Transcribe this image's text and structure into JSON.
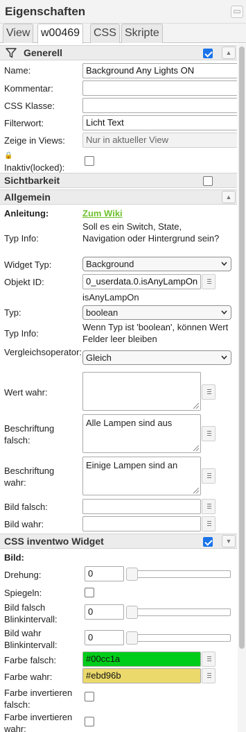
{
  "header": {
    "title": "Eigenschaften",
    "window_btn": "▭"
  },
  "tabs": [
    {
      "label": "View"
    },
    {
      "label": "w00469"
    },
    {
      "label": "CSS"
    },
    {
      "label": "Skripte"
    }
  ],
  "generell": {
    "title": "Generell",
    "name_label": "Name:",
    "name_value": "Background Any Lights ON",
    "kommentar_label": "Kommentar:",
    "kommentar_value": "",
    "css_klasse_label": "CSS Klasse:",
    "css_klasse_value": "",
    "filterwort_label": "Filterwort:",
    "filterwort_value": "Licht Text",
    "zeige_label": "Zeige in Views:",
    "zeige_value": "Nur in aktueller View",
    "inaktiv_label": "Inaktiv(locked):",
    "lock_glyph": "🔒"
  },
  "sichtbarkeit": {
    "title": "Sichtbarkeit"
  },
  "allgemein": {
    "title": "Allgemein",
    "anleitung_label": "Anleitung:",
    "anleitung_link": "Zum Wiki",
    "typinfo1_label": "Typ Info:",
    "typinfo1_text": "Soll es ein Switch, State, Navigation oder Hintergrund sein?",
    "widget_typ_label": "Widget Typ:",
    "widget_typ_value": "Background",
    "objekt_id_label": "Objekt ID:",
    "objekt_id_value": "0_userdata.0.isAnyLampOn",
    "objekt_id_name": "isAnyLampOn",
    "typ_label": "Typ:",
    "typ_value": "boolean",
    "typinfo2_label": "Typ Info:",
    "typinfo2_text": "Wenn Typ ist 'boolean', können Wert Felder leer bleiben",
    "vergleich_label": "Vergleichsoperator:",
    "vergleich_value": "Gleich",
    "wert_wahr_label": "Wert wahr:",
    "wert_wahr_value": "",
    "beschr_falsch_label": "Beschriftung falsch:",
    "beschr_falsch_value": "Alle Lampen sind aus",
    "beschr_wahr_label": "Beschriftung wahr:",
    "beschr_wahr_value": "Einige Lampen sind an",
    "bild_falsch_label": "Bild falsch:",
    "bild_falsch_value": "",
    "bild_wahr_label": "Bild wahr:",
    "bild_wahr_value": ""
  },
  "css_inventwo": {
    "title": "CSS inventwo Widget",
    "bild_label": "Bild:",
    "drehung_label": "Drehung:",
    "drehung_value": "0",
    "drehung_level": 0,
    "spiegeln_label": "Spiegeln:",
    "bild_falsch_blink_label": "Bild falsch Blinkintervall:",
    "bild_falsch_blink_value": "0",
    "bild_falsch_blink_level": 0,
    "bild_wahr_blink_label": "Bild wahr Blinkintervall:",
    "bild_wahr_blink_value": "0",
    "bild_wahr_blink_level": 0,
    "farbe_falsch_label": "Farbe falsch:",
    "farbe_falsch_value": "#00cc1a",
    "farbe_wahr_label": "Farbe wahr:",
    "farbe_wahr_value": "#ebd96b",
    "farbe_inv_falsch_label": "Farbe invertieren falsch:",
    "farbe_inv_wahr_label": "Farbe invertieren wahr:"
  },
  "colors": {
    "accent": "#1a73e8",
    "link": "#70c22f",
    "farbe_falsch": "#00cc1a",
    "farbe_wahr": "#ebd96b"
  },
  "icons": [
    "filter-icon",
    "chevron-up-icon",
    "chevron-down-icon",
    "lock-icon",
    "caret-down-icon",
    "ellipsis-icon",
    "resize-grip-icon"
  ]
}
